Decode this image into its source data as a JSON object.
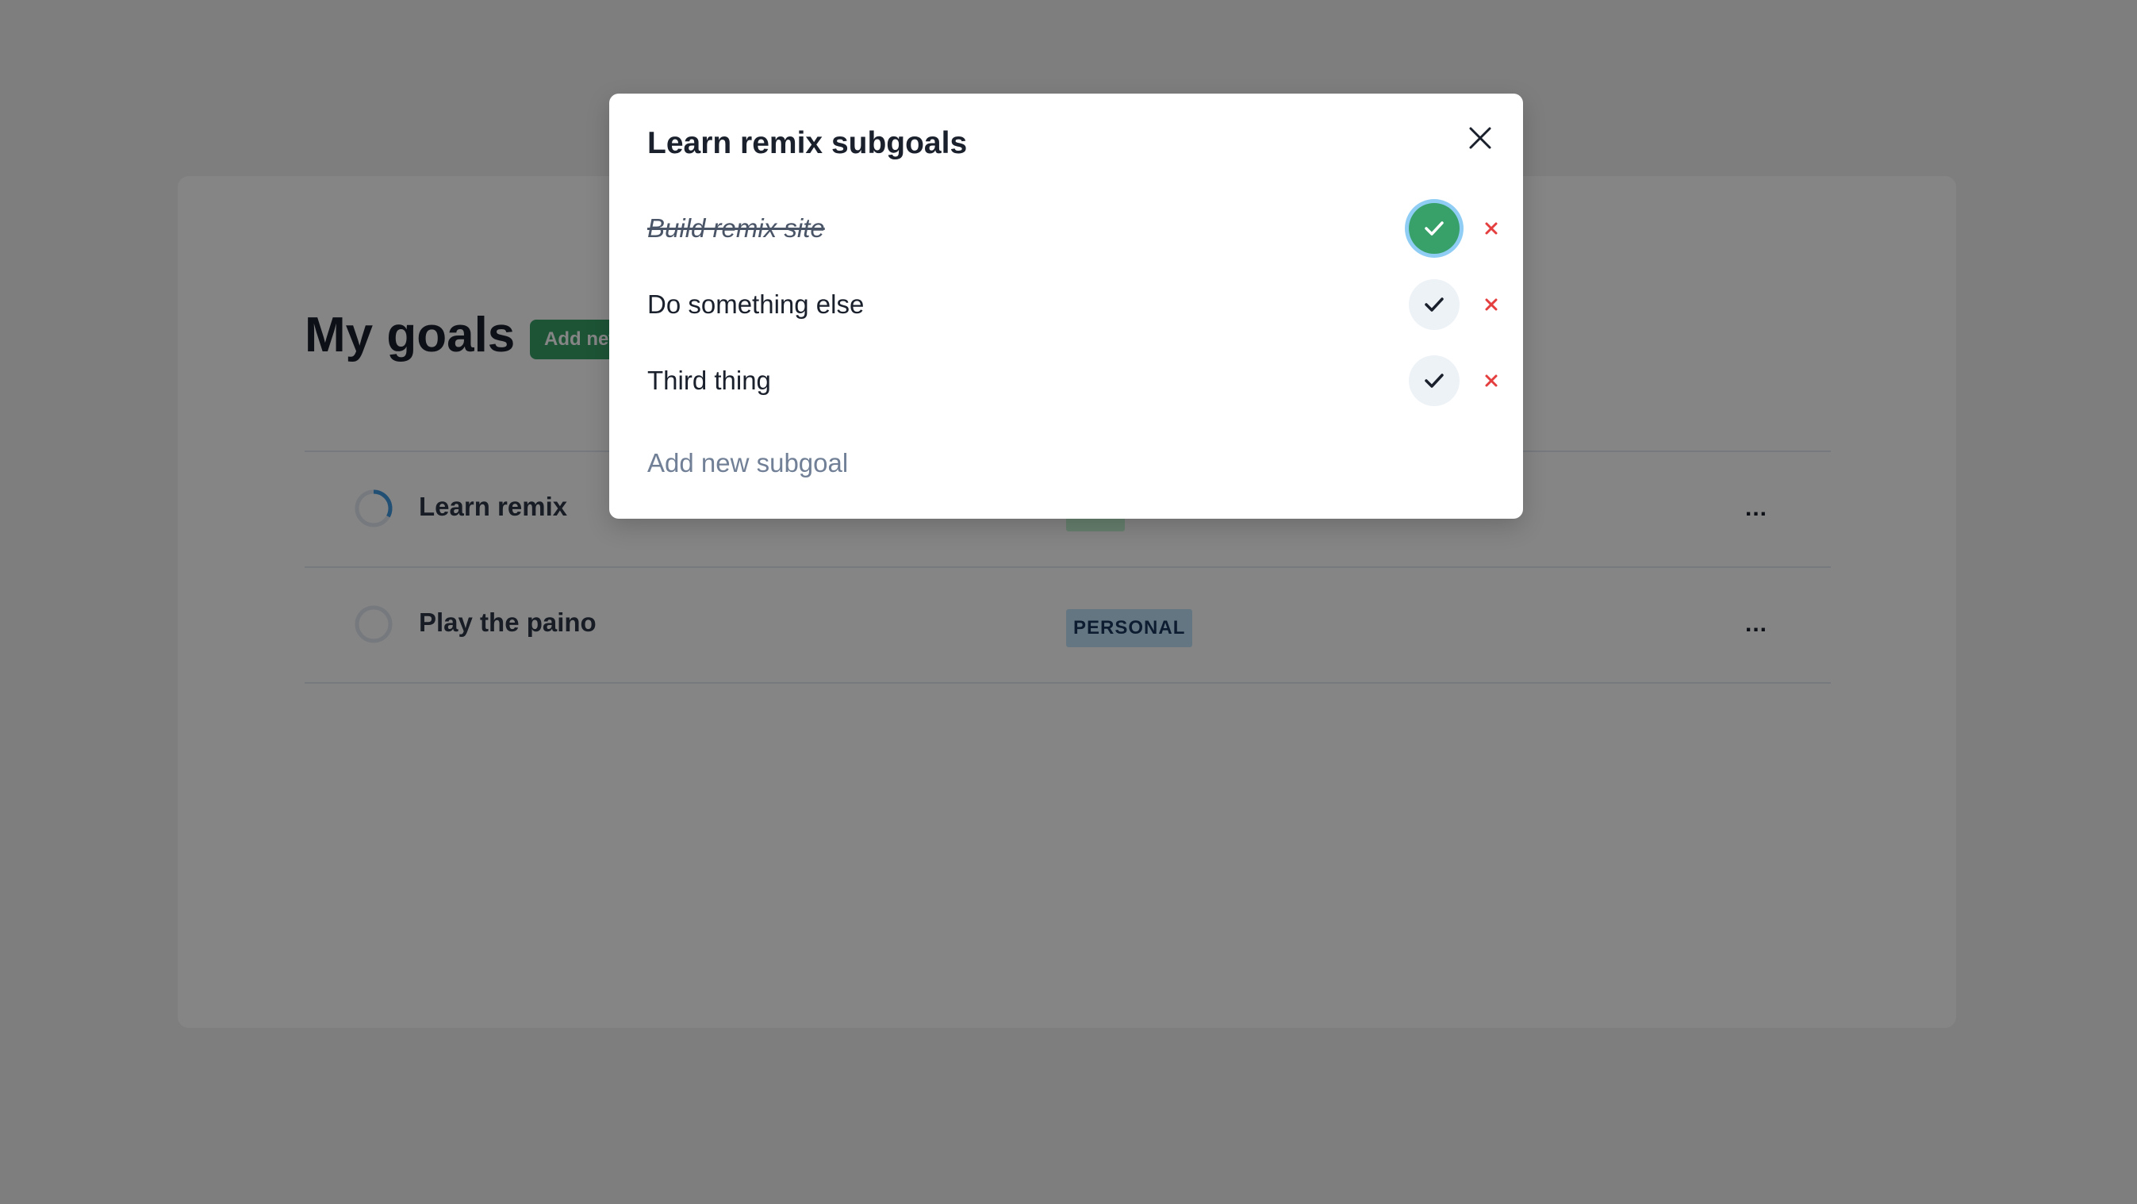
{
  "page": {
    "title": "My goals",
    "add_goal_label": "Add new goal",
    "goals": [
      {
        "name": "Learn remix",
        "tag": "",
        "tag_bg": "#c6f6d5",
        "tag_color": "#22543d",
        "progress": 0.33,
        "menu_label": "..."
      },
      {
        "name": "Play the paino",
        "tag": "PERSONAL",
        "tag_bg": "#bee3f8",
        "tag_color": "#1a365d",
        "progress": 0,
        "menu_label": "..."
      }
    ]
  },
  "modal": {
    "title": "Learn remix subgoals",
    "close_icon": "close-icon",
    "subgoals": [
      {
        "text": "Build remix site",
        "done": true
      },
      {
        "text": "Do something else",
        "done": false
      },
      {
        "text": "Third thing",
        "done": false
      }
    ],
    "add_placeholder": "Add new subgoal"
  },
  "colors": {
    "accent_green": "#38a169",
    "delete_red": "#e53e3e",
    "focus_ring": "#90cdf4"
  }
}
